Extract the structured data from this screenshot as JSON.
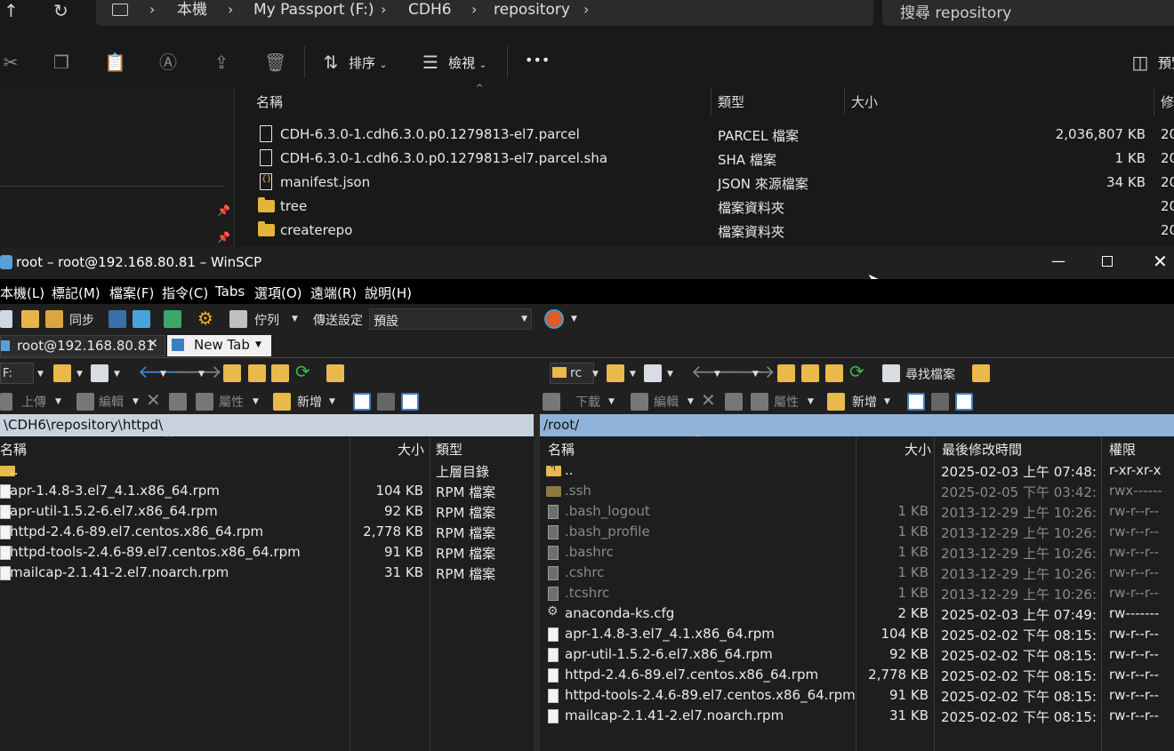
{
  "explorer": {
    "breadcrumbs": [
      "本機",
      "My Passport (F:)",
      "CDH6",
      "repository"
    ],
    "search_placeholder": "搜尋 repository",
    "toolbar": {
      "sort": "排序",
      "view": "檢視",
      "more": "•••",
      "preview": "預覽"
    },
    "columns": {
      "name": "名稱",
      "type": "類型",
      "size": "大小",
      "modified": "修"
    },
    "files": [
      {
        "name": "CDH-6.3.0-1.cdh6.3.0.p0.1279813-el7.parcel",
        "type": "PARCEL 檔案",
        "size": "2,036,807 KB",
        "mod": "20",
        "icon": "file-icon"
      },
      {
        "name": "CDH-6.3.0-1.cdh6.3.0.p0.1279813-el7.parcel.sha",
        "type": "SHA 檔案",
        "size": "1 KB",
        "mod": "20",
        "icon": "file-icon"
      },
      {
        "name": "manifest.json",
        "type": "JSON 來源檔案",
        "size": "34 KB",
        "mod": "20",
        "icon": "json-file-icon"
      },
      {
        "name": "tree",
        "type": "檔案資料夾",
        "size": "",
        "mod": "20",
        "icon": "folder-icon"
      },
      {
        "name": "createrepo",
        "type": "檔案資料夾",
        "size": "",
        "mod": "20",
        "icon": "folder-icon"
      }
    ]
  },
  "winscp": {
    "title": "root – root@192.168.80.81 – WinSCP",
    "menu": [
      "本機(L)",
      "標記(M)",
      "檔案(F)",
      "指令(C)",
      "Tabs",
      "選項(O)",
      "遠端(R)",
      "說明(H)"
    ],
    "toolbar": {
      "sync": "同步",
      "queue": "佇列",
      "transfer_label": "傳送設定",
      "transfer_value": "預設"
    },
    "tabs": {
      "session": "root@192.168.80.81",
      "new_tab": "New Tab"
    },
    "left": {
      "drive": "F:",
      "upload": "上傳",
      "edit": "編輯",
      "props": "屬性",
      "new": "新增",
      "path": "\\CDH6\\repository\\httpd\\",
      "columns": {
        "name": "名稱",
        "size": "大小",
        "type": "類型"
      },
      "files": [
        {
          "name": "..",
          "size": "",
          "type": "上層目錄"
        },
        {
          "name": "apr-1.4.8-3.el7_4.1.x86_64.rpm",
          "size": "104 KB",
          "type": "RPM 檔案"
        },
        {
          "name": "apr-util-1.5.2-6.el7.x86_64.rpm",
          "size": "92 KB",
          "type": "RPM 檔案"
        },
        {
          "name": "httpd-2.4.6-89.el7.centos.x86_64.rpm",
          "size": "2,778 KB",
          "type": "RPM 檔案"
        },
        {
          "name": "httpd-tools-2.4.6-89.el7.centos.x86_64.rpm",
          "size": "91 KB",
          "type": "RPM 檔案"
        },
        {
          "name": "mailcap-2.1.41-2.el7.noarch.rpm",
          "size": "31 KB",
          "type": "RPM 檔案"
        }
      ]
    },
    "right": {
      "drive": "rc",
      "find": "尋找檔案",
      "download": "下載",
      "edit": "編輯",
      "props": "屬性",
      "new": "新增",
      "path": "/root/",
      "columns": {
        "name": "名稱",
        "size": "大小",
        "modified": "最後修改時間",
        "rights": "權限"
      },
      "files": [
        {
          "name": "..",
          "size": "",
          "modified": "2025-02-03 上午 07:48:...",
          "rights": "r-xr-xr-x",
          "dim": false,
          "kind": "up"
        },
        {
          "name": ".ssh",
          "size": "",
          "modified": "2025-02-05 下午 03:42:...",
          "rights": "rwx------",
          "dim": true,
          "kind": "folder"
        },
        {
          "name": ".bash_logout",
          "size": "1 KB",
          "modified": "2013-12-29 上午 10:26:...",
          "rights": "rw-r--r--",
          "dim": true,
          "kind": "file"
        },
        {
          "name": ".bash_profile",
          "size": "1 KB",
          "modified": "2013-12-29 上午 10:26:...",
          "rights": "rw-r--r--",
          "dim": true,
          "kind": "file"
        },
        {
          "name": ".bashrc",
          "size": "1 KB",
          "modified": "2013-12-29 上午 10:26:...",
          "rights": "rw-r--r--",
          "dim": true,
          "kind": "file"
        },
        {
          "name": ".cshrc",
          "size": "1 KB",
          "modified": "2013-12-29 上午 10:26:...",
          "rights": "rw-r--r--",
          "dim": true,
          "kind": "file"
        },
        {
          "name": ".tcshrc",
          "size": "1 KB",
          "modified": "2013-12-29 上午 10:26:...",
          "rights": "rw-r--r--",
          "dim": true,
          "kind": "file"
        },
        {
          "name": "anaconda-ks.cfg",
          "size": "2 KB",
          "modified": "2025-02-03 上午 07:49:...",
          "rights": "rw-------",
          "dim": false,
          "kind": "cfg"
        },
        {
          "name": "apr-1.4.8-3.el7_4.1.x86_64.rpm",
          "size": "104 KB",
          "modified": "2025-02-02 下午 08:15:...",
          "rights": "rw-r--r--",
          "dim": false,
          "kind": "file"
        },
        {
          "name": "apr-util-1.5.2-6.el7.x86_64.rpm",
          "size": "92 KB",
          "modified": "2025-02-02 下午 08:15:...",
          "rights": "rw-r--r--",
          "dim": false,
          "kind": "file"
        },
        {
          "name": "httpd-2.4.6-89.el7.centos.x86_64.rpm",
          "size": "2,778 KB",
          "modified": "2025-02-02 下午 08:15:...",
          "rights": "rw-r--r--",
          "dim": false,
          "kind": "file"
        },
        {
          "name": "httpd-tools-2.4.6-89.el7.centos.x86_64.rpm",
          "size": "91 KB",
          "modified": "2025-02-02 下午 08:15:...",
          "rights": "rw-r--r--",
          "dim": false,
          "kind": "file"
        },
        {
          "name": "mailcap-2.1.41-2.el7.noarch.rpm",
          "size": "31 KB",
          "modified": "2025-02-02 下午 08:15:...",
          "rights": "rw-r--r--",
          "dim": false,
          "kind": "file"
        }
      ]
    }
  }
}
